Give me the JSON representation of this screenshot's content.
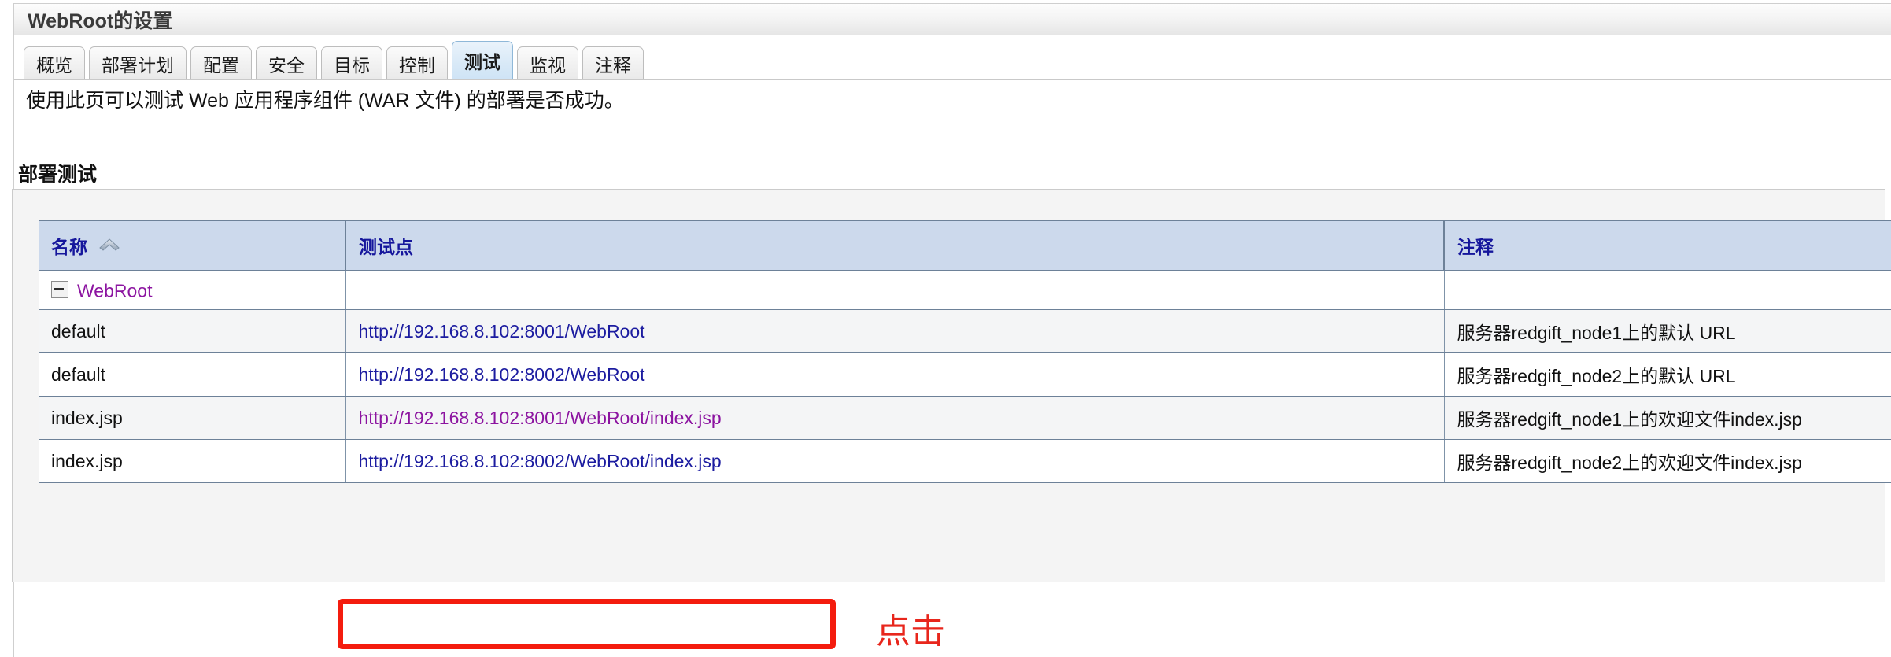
{
  "window": {
    "title": "WebRoot的设置"
  },
  "tabs": [
    {
      "label": "概览",
      "active": false
    },
    {
      "label": "部署计划",
      "active": false
    },
    {
      "label": "配置",
      "active": false
    },
    {
      "label": "安全",
      "active": false
    },
    {
      "label": "目标",
      "active": false
    },
    {
      "label": "控制",
      "active": false
    },
    {
      "label": "测试",
      "active": true
    },
    {
      "label": "监视",
      "active": false
    },
    {
      "label": "注释",
      "active": false
    }
  ],
  "main": {
    "intro": "使用此页可以测试 Web 应用程序组件 (WAR 文件) 的部署是否成功。",
    "section_title": "部署测试"
  },
  "table": {
    "headers": {
      "name": "名称",
      "testpoint": "测试点",
      "note": "注释"
    },
    "sort_icon": "sort-ascending-caret",
    "tree_root": {
      "label": "WebRoot",
      "toggle_icon": "collapse-minus-box",
      "expanded": true
    },
    "rows": [
      {
        "name": "default",
        "url": "http://192.168.8.102:8001/WebRoot",
        "visited": false,
        "note": "服务器redgift_node1上的默认 URL"
      },
      {
        "name": "default",
        "url": "http://192.168.8.102:8002/WebRoot",
        "visited": false,
        "note": "服务器redgift_node2上的默认 URL"
      },
      {
        "name": "index.jsp",
        "url": "http://192.168.8.102:8001/WebRoot/index.jsp",
        "visited": true,
        "note": "服务器redgift_node1上的欢迎文件index.jsp"
      },
      {
        "name": "index.jsp",
        "url": "http://192.168.8.102:8002/WebRoot/index.jsp",
        "visited": false,
        "note": "服务器redgift_node2上的欢迎文件index.jsp"
      }
    ]
  },
  "annotation": {
    "label": "点击",
    "color": "#e8261c",
    "box_color": "#f41c0e",
    "target_url": "http://192.168.8.102:8002/WebRoot/index.jsp"
  },
  "colors": {
    "header_row_bg": "#ccd9ec",
    "header_text": "#15169c",
    "link": "#1c1ca0",
    "link_visited": "#8c14a0",
    "active_tab_bg": "#d8e9f7",
    "panel_bg": "#f4f4f4",
    "grid_border": "#6d8198"
  }
}
